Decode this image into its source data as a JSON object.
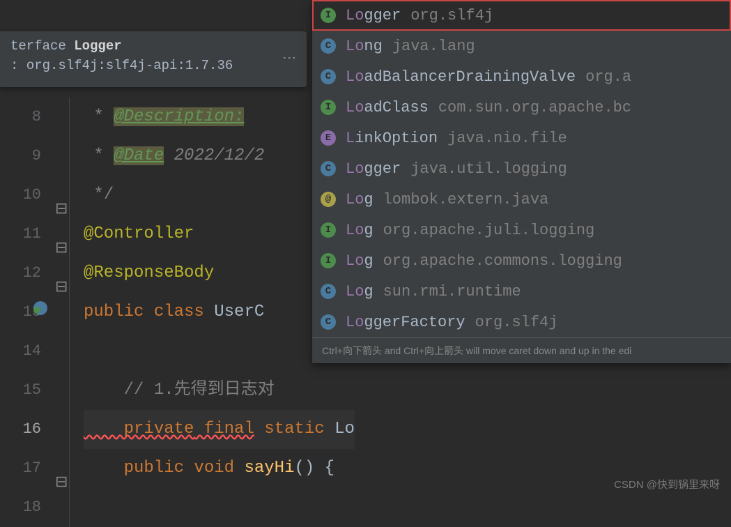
{
  "doc": {
    "prefix": "terface ",
    "classname": "Logger",
    "artifact": ": org.slf4j:slf4j-api:1.7.36"
  },
  "gutter": {
    "lines": [
      "8",
      "9",
      "10",
      "11",
      "12",
      "13",
      "14",
      "15",
      "16",
      "17",
      "18"
    ]
  },
  "code": {
    "l8_star": " * ",
    "l8_tag": "@Description:",
    "l9_star": " * ",
    "l9_tag": "@Date",
    "l9_rest": " 2022/12/2",
    "l10": " */",
    "l11": "@Controller",
    "l12": "@ResponseBody",
    "l13_kw": "public class ",
    "l13_id": "UserC",
    "l15_cm": "    // 1.先得到日志对",
    "l16_p": "    private",
    "l16_f": " final",
    "l16_s": " static",
    "l16_lo": " Lo",
    "l17_p": "    public",
    "l17_v": " void ",
    "l17_m": "sayHi",
    "l17_r": "() {"
  },
  "autocomplete": {
    "items": [
      {
        "icon": "I",
        "iconClass": "icon-I",
        "match": "Lo",
        "rest": "gger",
        "pkg": "org.slf4j"
      },
      {
        "icon": "C",
        "iconClass": "icon-C",
        "match": "Lo",
        "rest": "ng",
        "pkg": "java.lang"
      },
      {
        "icon": "C",
        "iconClass": "icon-C",
        "match": "Lo",
        "rest": "adBalancerDrainingValve",
        "pkg": "org.a"
      },
      {
        "icon": "I",
        "iconClass": "icon-I",
        "match": "Lo",
        "rest": "adClass",
        "pkg": "com.sun.org.apache.bc"
      },
      {
        "icon": "E",
        "iconClass": "icon-E",
        "match": "L",
        "rest": "inkOption",
        "pkg": "java.nio.file"
      },
      {
        "icon": "C",
        "iconClass": "icon-C",
        "match": "Lo",
        "rest": "gger",
        "pkg": "java.util.logging"
      },
      {
        "icon": "@",
        "iconClass": "icon-AT",
        "match": "Lo",
        "rest": "g",
        "pkg": "lombok.extern.java"
      },
      {
        "icon": "I",
        "iconClass": "icon-I",
        "match": "Lo",
        "rest": "g",
        "pkg": "org.apache.juli.logging"
      },
      {
        "icon": "I",
        "iconClass": "icon-I",
        "match": "Lo",
        "rest": "g",
        "pkg": "org.apache.commons.logging"
      },
      {
        "icon": "C",
        "iconClass": "icon-C",
        "match": "Lo",
        "rest": "g",
        "pkg": "sun.rmi.runtime"
      },
      {
        "icon": "C",
        "iconClass": "icon-C",
        "match": "Lo",
        "rest": "ggerFactory",
        "pkg": "org.slf4j"
      }
    ],
    "hint": "Ctrl+向下箭头 and Ctrl+向上箭头 will move caret down and up in the edi"
  },
  "watermark": "CSDN @快到锅里来呀"
}
